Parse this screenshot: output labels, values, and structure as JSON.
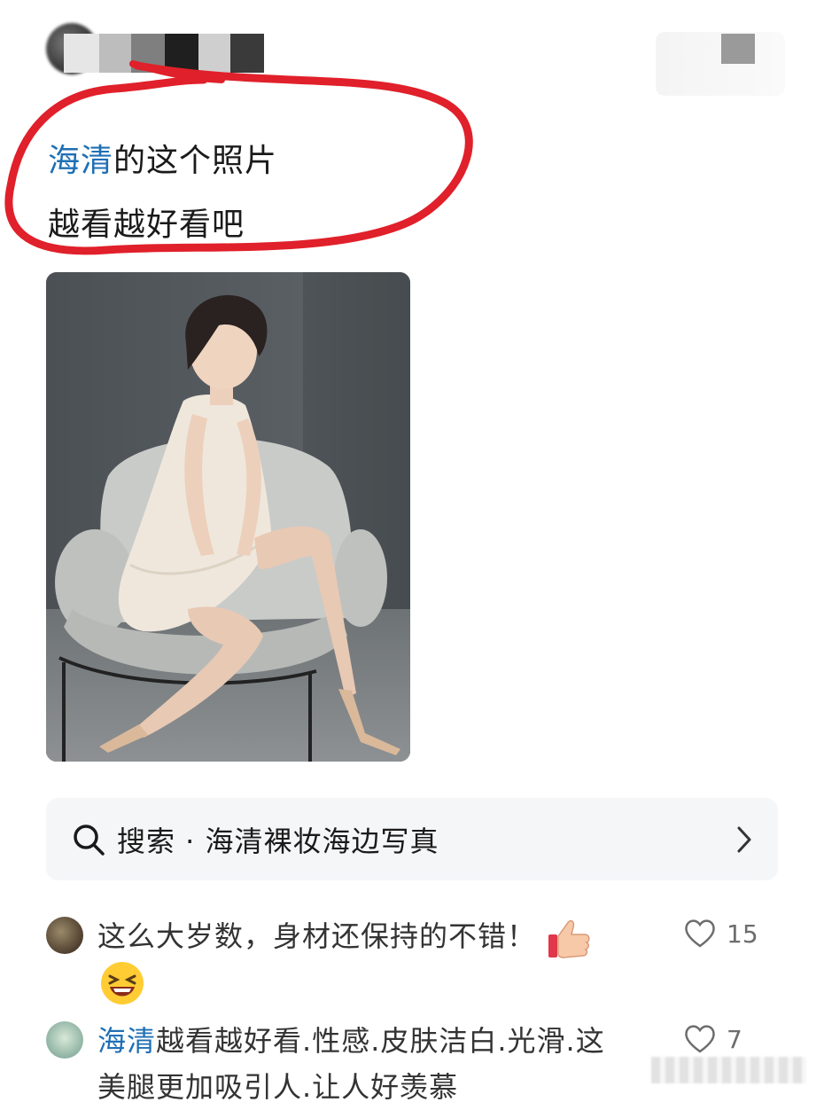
{
  "post": {
    "topic": "海清",
    "line1_rest": "的这个照片",
    "line2": "越看越好看吧"
  },
  "search": {
    "icon": "search-icon",
    "label": "搜索 · 海清裸妆海边写真"
  },
  "comments": [
    {
      "text": "这么大岁数，身材还保持的不错！",
      "emojis": [
        "thumbs-up-emoji",
        "laughing-emoji"
      ],
      "likes": "15"
    },
    {
      "author": "海清",
      "text_line1": "越看越好看.性感.皮肤洁白.光滑.这",
      "text_line2": "美腿更加吸引人.让人好羡慕",
      "likes": "7"
    }
  ],
  "colors": {
    "topic_blue": "#1f6fb5",
    "annotation_red": "#e0202a",
    "search_bg": "#f5f6f8"
  }
}
